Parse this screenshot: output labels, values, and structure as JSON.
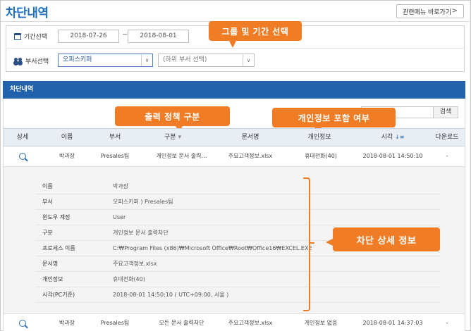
{
  "header": {
    "title": "차단내역",
    "related_button": "관련메뉴 바로가기",
    "related_chevron": ">"
  },
  "filters": {
    "period_label": "기간선택",
    "start_date": "2018-07-26",
    "end_date": "2018-08-01",
    "tilde": "~",
    "dept_label": "부서선택",
    "dept_selected": "오피스키퍼",
    "subdept_placeholder": "(하위 부서 선택)"
  },
  "callouts": {
    "group_period": "그룹 및 기간 선택",
    "output_policy": "출력 정책 구분",
    "privacy_included": "개인정보 포함 여부",
    "block_detail": "차단 상세 정보"
  },
  "panel": {
    "title": "차단내역",
    "search_button": "검색"
  },
  "table": {
    "columns": [
      "상세",
      "이름",
      "부서",
      "구분",
      "문서명",
      "개인정보",
      "시각",
      "다운로드"
    ],
    "sort_mark_category": "▾",
    "sort_mark_time": "↓≡",
    "rows": [
      {
        "name": "박과장",
        "dept": "Presales팀",
        "category": "개인정보 문서 출력…",
        "doc": "주요고객정보.xlsx",
        "privacy": "휴대전화(40)",
        "time": "2018-08-01 14:50:10",
        "download": "-"
      },
      {
        "name": "박과장",
        "dept": "Presales팀",
        "category": "모든 문서 출력차단",
        "doc": "주요고객정보.xlsx",
        "privacy": "개인정보 없음",
        "time": "2018-08-01 14:37:03",
        "download": "-"
      }
    ]
  },
  "detail": [
    {
      "label": "이름",
      "value": "박과장"
    },
    {
      "label": "부서",
      "value": "오피스키퍼 ) Presales팀"
    },
    {
      "label": "윈도우 계정",
      "value": "User"
    },
    {
      "label": "구분",
      "value": "개인정보 문서 출력차단"
    },
    {
      "label": "프로세스 이름",
      "value": "C:₩Program Files (x86)₩Microsoft Office₩Root₩Office16₩EXCEL.EXE"
    },
    {
      "label": "문서명",
      "value": "주요고객정보.xlsx"
    },
    {
      "label": "개인정보",
      "value": "휴대전화(40)"
    },
    {
      "label": "시각(PC기준)",
      "value": "2018-08-01 14:50:10 ( UTC+09:00, 서울 )"
    }
  ],
  "colors": {
    "accent": "#f07d25",
    "header_blue": "#2262ad",
    "title_blue": "#1f6fbf"
  }
}
